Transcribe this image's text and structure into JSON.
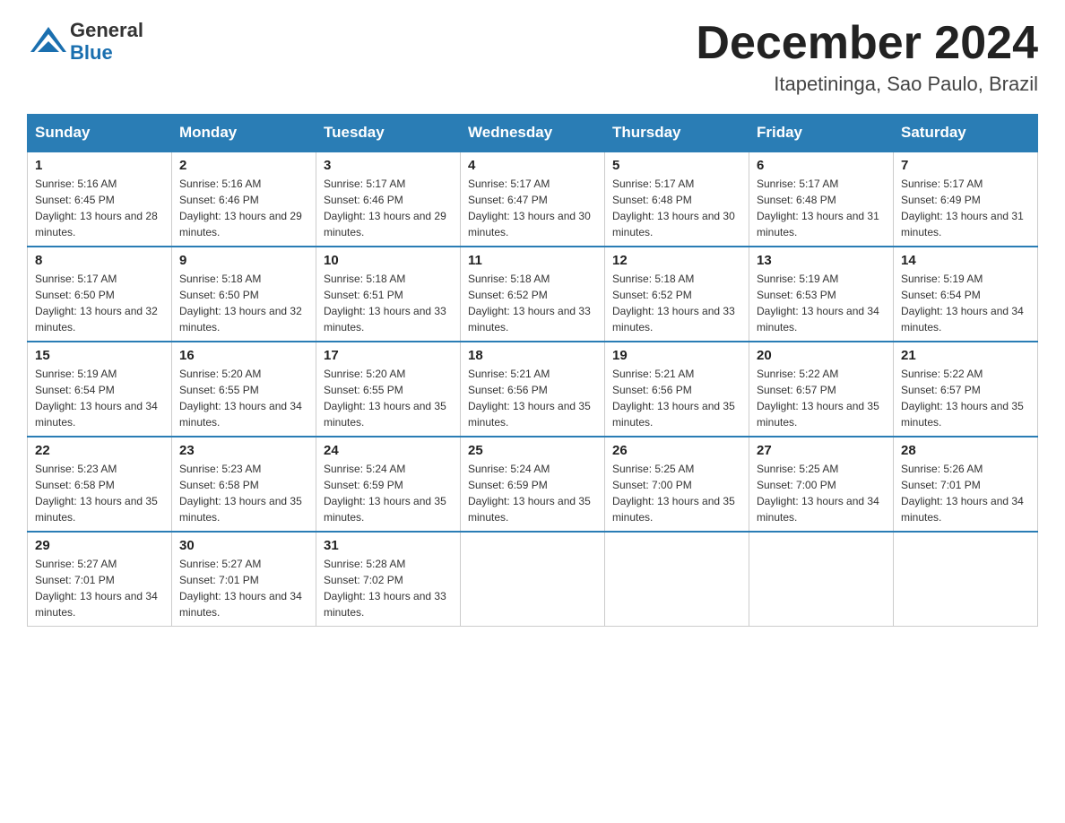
{
  "header": {
    "logo_line1": "General",
    "logo_line2": "Blue",
    "month_title": "December 2024",
    "location": "Itapetininga, Sao Paulo, Brazil"
  },
  "days_of_week": [
    "Sunday",
    "Monday",
    "Tuesday",
    "Wednesday",
    "Thursday",
    "Friday",
    "Saturday"
  ],
  "weeks": [
    [
      {
        "day": "1",
        "sunrise": "5:16 AM",
        "sunset": "6:45 PM",
        "daylight": "13 hours and 28 minutes."
      },
      {
        "day": "2",
        "sunrise": "5:16 AM",
        "sunset": "6:46 PM",
        "daylight": "13 hours and 29 minutes."
      },
      {
        "day": "3",
        "sunrise": "5:17 AM",
        "sunset": "6:46 PM",
        "daylight": "13 hours and 29 minutes."
      },
      {
        "day": "4",
        "sunrise": "5:17 AM",
        "sunset": "6:47 PM",
        "daylight": "13 hours and 30 minutes."
      },
      {
        "day": "5",
        "sunrise": "5:17 AM",
        "sunset": "6:48 PM",
        "daylight": "13 hours and 30 minutes."
      },
      {
        "day": "6",
        "sunrise": "5:17 AM",
        "sunset": "6:48 PM",
        "daylight": "13 hours and 31 minutes."
      },
      {
        "day": "7",
        "sunrise": "5:17 AM",
        "sunset": "6:49 PM",
        "daylight": "13 hours and 31 minutes."
      }
    ],
    [
      {
        "day": "8",
        "sunrise": "5:17 AM",
        "sunset": "6:50 PM",
        "daylight": "13 hours and 32 minutes."
      },
      {
        "day": "9",
        "sunrise": "5:18 AM",
        "sunset": "6:50 PM",
        "daylight": "13 hours and 32 minutes."
      },
      {
        "day": "10",
        "sunrise": "5:18 AM",
        "sunset": "6:51 PM",
        "daylight": "13 hours and 33 minutes."
      },
      {
        "day": "11",
        "sunrise": "5:18 AM",
        "sunset": "6:52 PM",
        "daylight": "13 hours and 33 minutes."
      },
      {
        "day": "12",
        "sunrise": "5:18 AM",
        "sunset": "6:52 PM",
        "daylight": "13 hours and 33 minutes."
      },
      {
        "day": "13",
        "sunrise": "5:19 AM",
        "sunset": "6:53 PM",
        "daylight": "13 hours and 34 minutes."
      },
      {
        "day": "14",
        "sunrise": "5:19 AM",
        "sunset": "6:54 PM",
        "daylight": "13 hours and 34 minutes."
      }
    ],
    [
      {
        "day": "15",
        "sunrise": "5:19 AM",
        "sunset": "6:54 PM",
        "daylight": "13 hours and 34 minutes."
      },
      {
        "day": "16",
        "sunrise": "5:20 AM",
        "sunset": "6:55 PM",
        "daylight": "13 hours and 34 minutes."
      },
      {
        "day": "17",
        "sunrise": "5:20 AM",
        "sunset": "6:55 PM",
        "daylight": "13 hours and 35 minutes."
      },
      {
        "day": "18",
        "sunrise": "5:21 AM",
        "sunset": "6:56 PM",
        "daylight": "13 hours and 35 minutes."
      },
      {
        "day": "19",
        "sunrise": "5:21 AM",
        "sunset": "6:56 PM",
        "daylight": "13 hours and 35 minutes."
      },
      {
        "day": "20",
        "sunrise": "5:22 AM",
        "sunset": "6:57 PM",
        "daylight": "13 hours and 35 minutes."
      },
      {
        "day": "21",
        "sunrise": "5:22 AM",
        "sunset": "6:57 PM",
        "daylight": "13 hours and 35 minutes."
      }
    ],
    [
      {
        "day": "22",
        "sunrise": "5:23 AM",
        "sunset": "6:58 PM",
        "daylight": "13 hours and 35 minutes."
      },
      {
        "day": "23",
        "sunrise": "5:23 AM",
        "sunset": "6:58 PM",
        "daylight": "13 hours and 35 minutes."
      },
      {
        "day": "24",
        "sunrise": "5:24 AM",
        "sunset": "6:59 PM",
        "daylight": "13 hours and 35 minutes."
      },
      {
        "day": "25",
        "sunrise": "5:24 AM",
        "sunset": "6:59 PM",
        "daylight": "13 hours and 35 minutes."
      },
      {
        "day": "26",
        "sunrise": "5:25 AM",
        "sunset": "7:00 PM",
        "daylight": "13 hours and 35 minutes."
      },
      {
        "day": "27",
        "sunrise": "5:25 AM",
        "sunset": "7:00 PM",
        "daylight": "13 hours and 34 minutes."
      },
      {
        "day": "28",
        "sunrise": "5:26 AM",
        "sunset": "7:01 PM",
        "daylight": "13 hours and 34 minutes."
      }
    ],
    [
      {
        "day": "29",
        "sunrise": "5:27 AM",
        "sunset": "7:01 PM",
        "daylight": "13 hours and 34 minutes."
      },
      {
        "day": "30",
        "sunrise": "5:27 AM",
        "sunset": "7:01 PM",
        "daylight": "13 hours and 34 minutes."
      },
      {
        "day": "31",
        "sunrise": "5:28 AM",
        "sunset": "7:02 PM",
        "daylight": "13 hours and 33 minutes."
      },
      null,
      null,
      null,
      null
    ]
  ]
}
